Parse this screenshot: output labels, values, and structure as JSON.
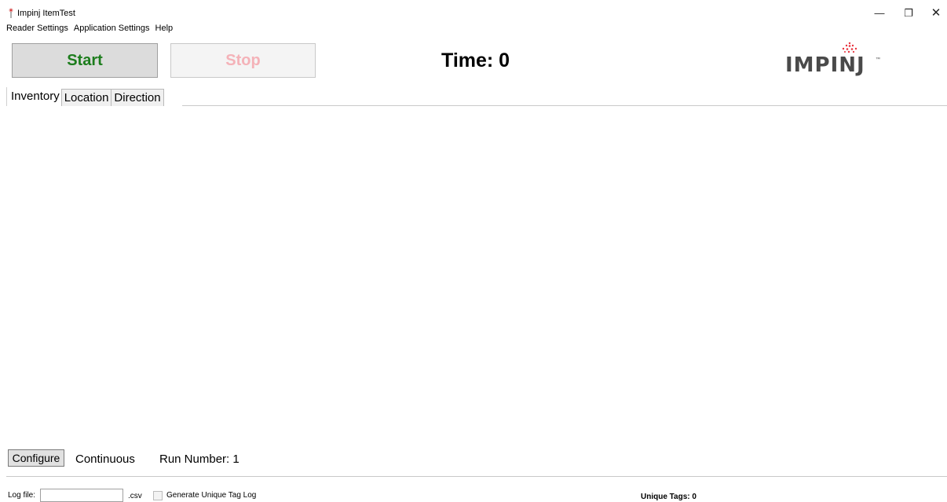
{
  "window": {
    "title": "Impinj ItemTest",
    "minimize_glyph": "—",
    "maximize_glyph": "❐",
    "close_glyph": "✕"
  },
  "menu": {
    "items": [
      {
        "label": "Reader Settings"
      },
      {
        "label": "Application Settings"
      },
      {
        "label": "Help"
      }
    ]
  },
  "toolbar": {
    "start_label": "Start",
    "stop_label": "Stop",
    "time_label": "Time: 0",
    "logo_text": "IMPINJ",
    "logo_tm": "™"
  },
  "tabs": [
    {
      "label": "Inventory",
      "active": true
    },
    {
      "label": "Location",
      "active": false
    },
    {
      "label": "Direction",
      "active": false
    }
  ],
  "panel": {
    "configure_label": "Configure",
    "mode_label": "Continuous",
    "run_label": "Run Number: 1"
  },
  "status": {
    "log_label": "Log file:",
    "log_value": "",
    "csv_label": ".csv",
    "checkbox_label": "Generate Unique Tag Log",
    "checkbox_checked": false,
    "unique_tags_label": "Unique Tags: 0"
  },
  "colors": {
    "start_text": "#1d7d1d",
    "stop_text_disabled": "#f4b2b8",
    "logo_dots": "#e8333f",
    "logo_text": "#4a4a4a"
  },
  "icons": {
    "app": "antenna-icon",
    "logo": "impinj-logo"
  }
}
